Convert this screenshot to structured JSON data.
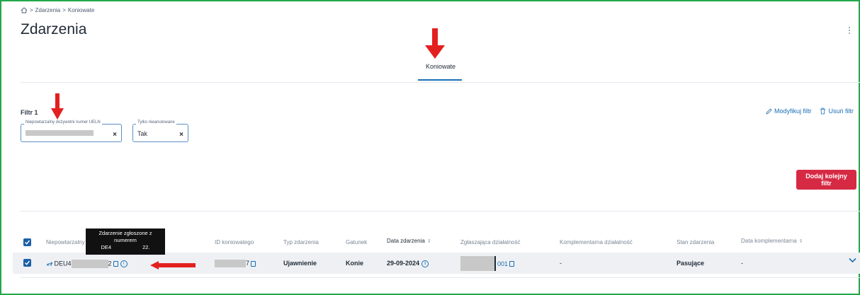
{
  "breadcrumb": {
    "items": [
      "Zdarzenia",
      "Koniowate"
    ],
    "separator": ">"
  },
  "page": {
    "title": "Zdarzenia"
  },
  "tabs": [
    {
      "label": "Koniowate",
      "active": true
    }
  ],
  "filter": {
    "title": "Filtr 1",
    "modify_label": "Modyfikuj filtr",
    "remove_label": "Usuń filtr",
    "chips": [
      {
        "label": "Niepowtarzalny dożywotni numer UELN",
        "value": ""
      },
      {
        "label": "Tylko nieanulowane",
        "value": "Tak"
      }
    ],
    "add_button_label": "Dodaj kolejny filtr"
  },
  "table": {
    "headers": {
      "ueln": "Niepowtarzalny",
      "id_koniowatego": "ID koniowatego",
      "typ": "Typ zdarzenia",
      "gatunek": "Gatunek",
      "data": "Data zdarzenia",
      "zglaszajaca": "Zgłaszająca działalność",
      "komplementarna": "Komplementarna działalność",
      "stan": "Stan zdarzenia",
      "data_komp": "Data komplementarna"
    },
    "row": {
      "ueln_prefix": "DEU4",
      "ueln_suffix": "2",
      "id_suffix": "7",
      "typ": "Ujawnienie",
      "gatunek": "Konie",
      "data": "29-09-2024",
      "zglaszajaca_suffix": "001",
      "komplementarna": "-",
      "stan": "Pasujące",
      "data_komp": "-"
    },
    "tooltip": {
      "line1": "Zdarzenie zgłoszone z",
      "line2": "numerem",
      "num_prefix": "DE4",
      "num_suffix": "22."
    }
  },
  "colors": {
    "accent": "#1a6fb5",
    "button": "#d62a44",
    "annotation_arrow": "#e32020",
    "frame": "#22a84a"
  }
}
